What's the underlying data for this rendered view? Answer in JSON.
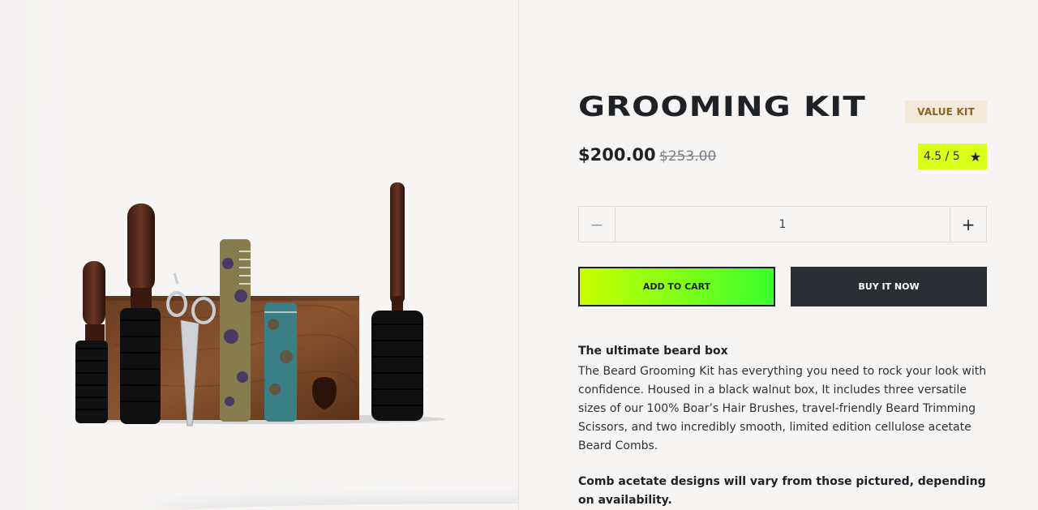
{
  "product": {
    "title": "GROOMING KIT",
    "badge": "VALUE KIT",
    "price": "$200.00",
    "compare_price": "$253.00",
    "rating": "4.5 / 5",
    "rating_icon": "star-icon"
  },
  "quantity": {
    "value": "1",
    "minus_symbol": "−",
    "plus_symbol": "+"
  },
  "actions": {
    "add_to_cart": "ADD TO CART",
    "buy_now": "BUY IT NOW"
  },
  "description": {
    "heading": "The ultimate beard box",
    "body": "The Beard Grooming Kit has everything you need to rock your look with confidence. Housed in a black walnut box, It includes three versatile sizes of our 100% Boar’s Hair Brushes, travel-friendly Beard Trimming Scissors, and two incredibly smooth, limited edition cellulose acetate Beard Combs.",
    "note": "Comb acetate designs will vary from those pictured, depending on availability."
  },
  "colors": {
    "accent_lime": "#dbff1a",
    "badge_bg": "#f4e8da",
    "dark_button": "#2b2e33"
  }
}
